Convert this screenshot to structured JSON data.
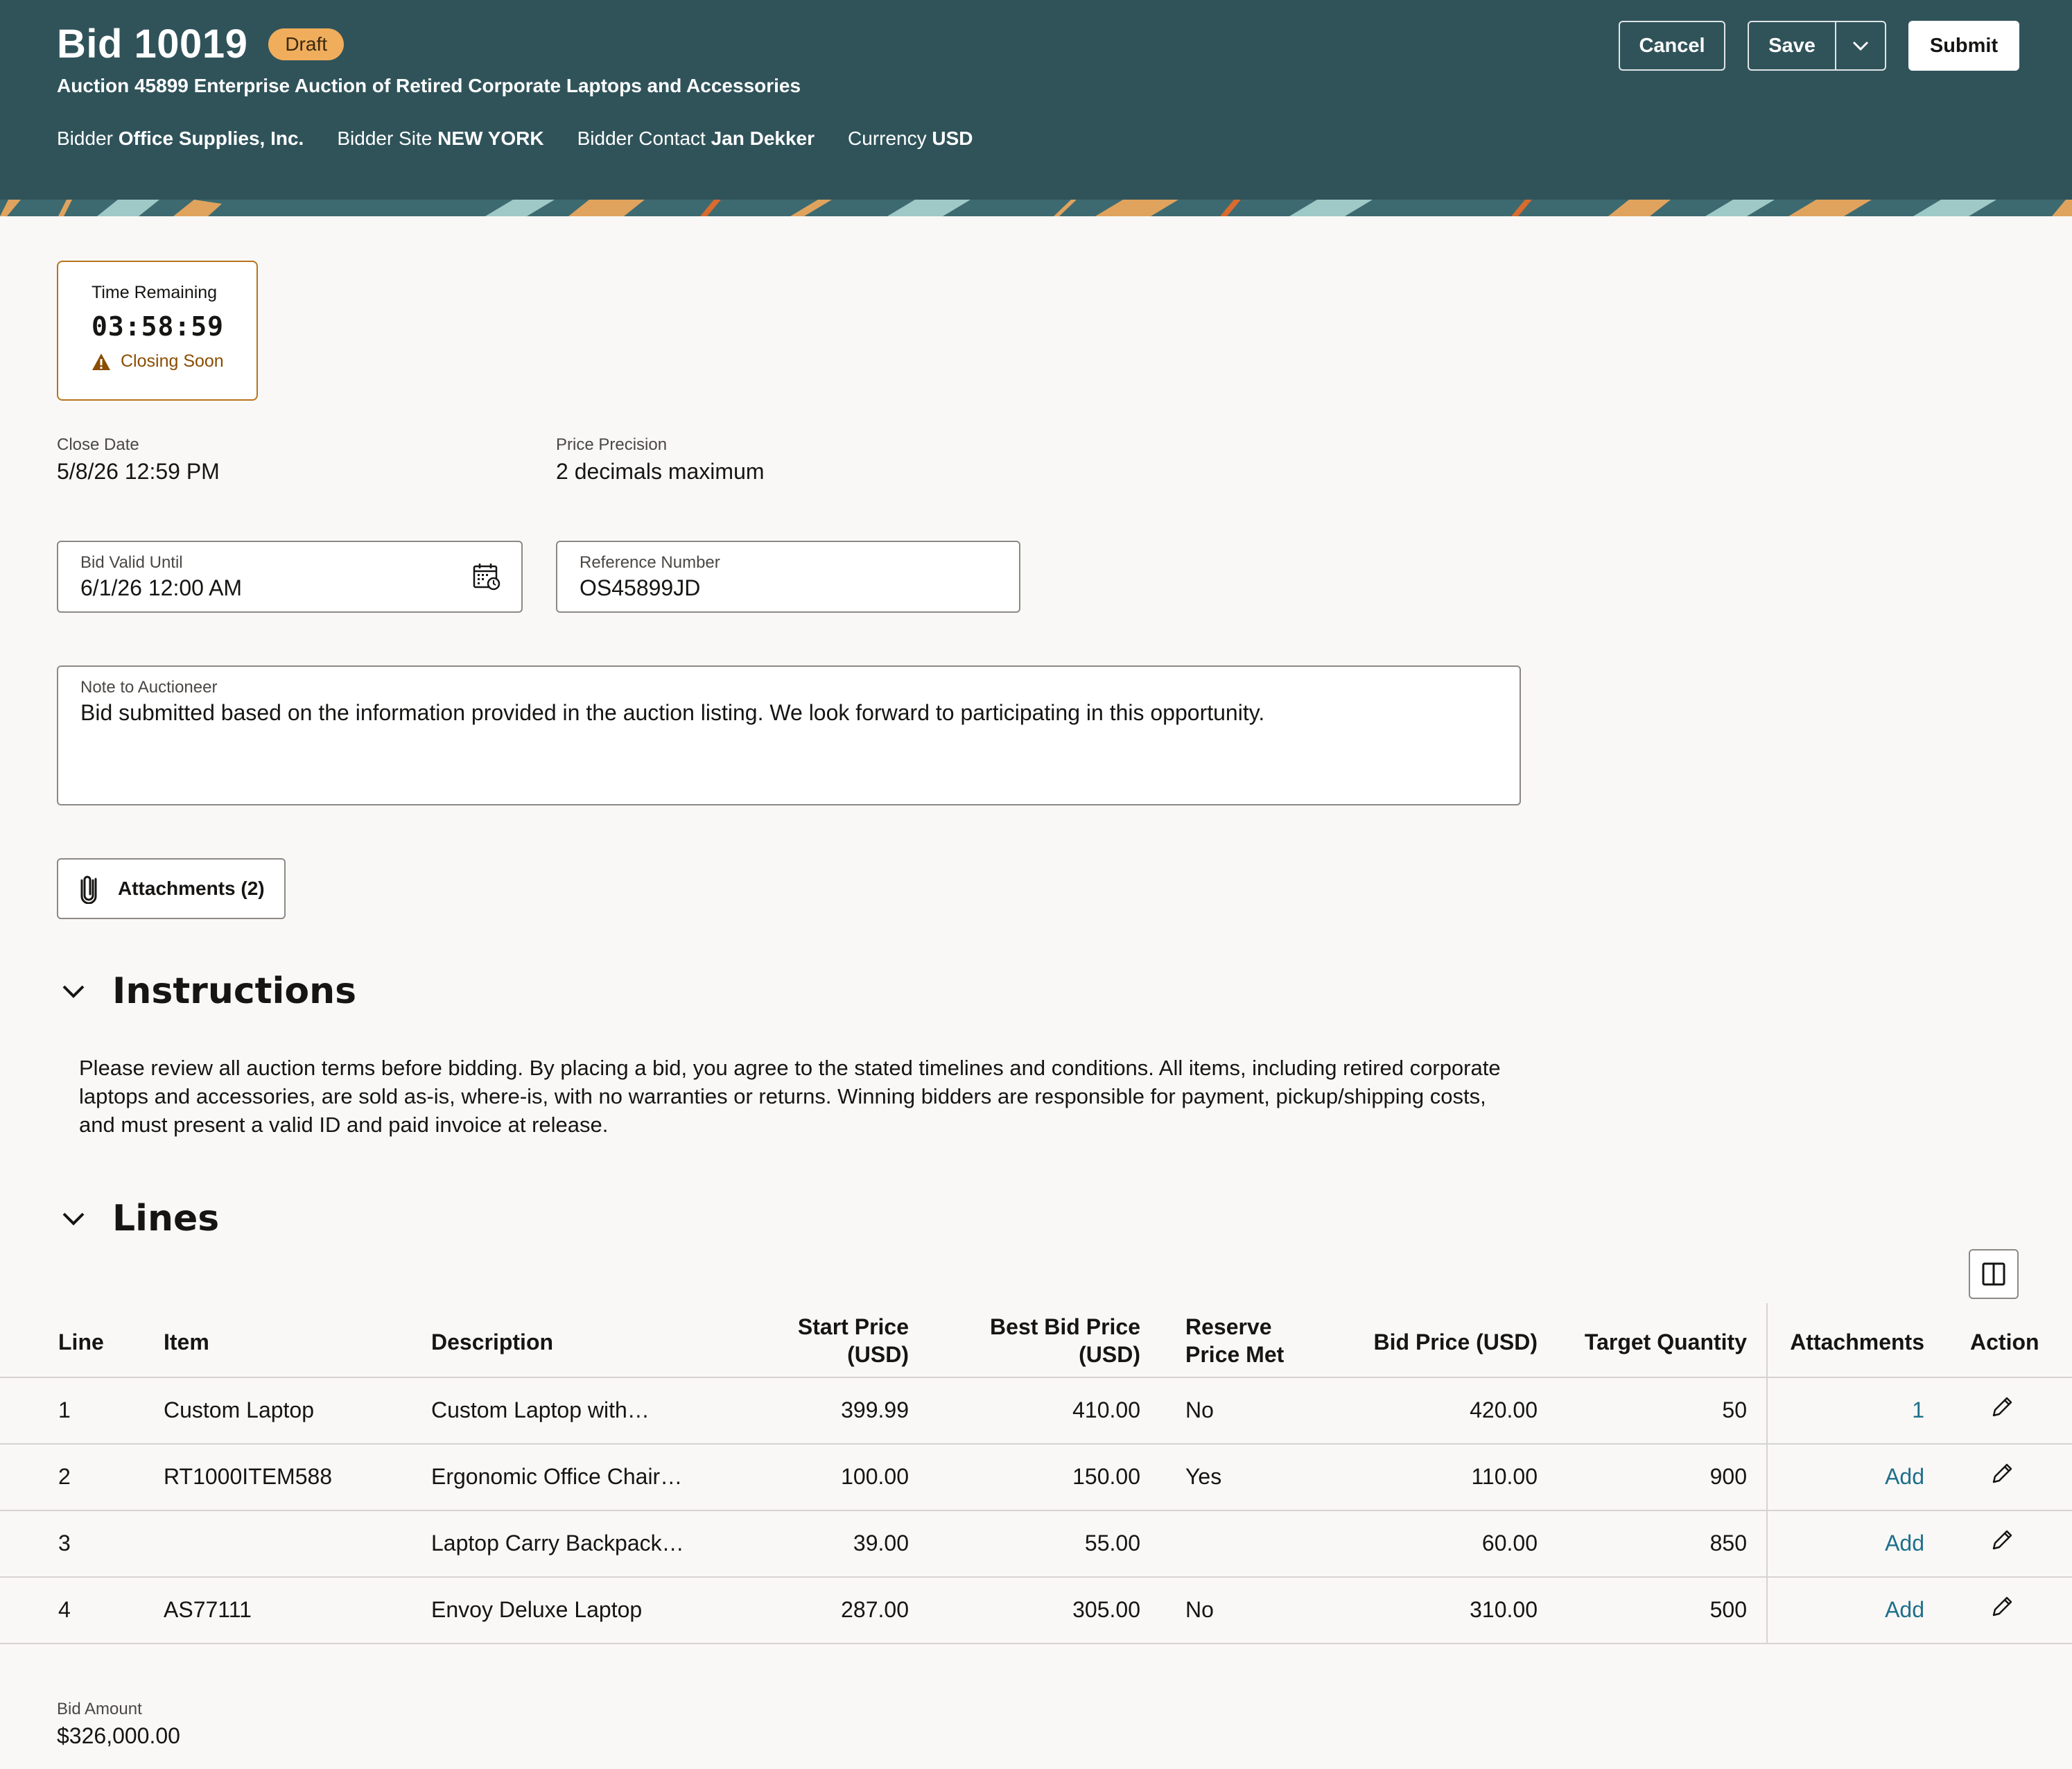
{
  "header": {
    "title": "Bid 10019",
    "status": "Draft",
    "subtitle": "Auction 45899 Enterprise Auction of Retired Corporate Laptops and Accessories",
    "meta": {
      "bidder_label": "Bidder",
      "bidder_value": "Office Supplies, Inc.",
      "site_label": "Bidder Site",
      "site_value": "NEW YORK",
      "contact_label": "Bidder Contact",
      "contact_value": "Jan Dekker",
      "currency_label": "Currency",
      "currency_value": "USD"
    },
    "buttons": {
      "cancel": "Cancel",
      "save": "Save",
      "submit": "Submit"
    },
    "colors": {
      "header_bg": "#30535a",
      "badge_bg": "#f0ad5c"
    }
  },
  "timer": {
    "label": "Time Remaining",
    "value": "03:58:59",
    "status": "Closing Soon"
  },
  "fields": {
    "close_date_label": "Close Date",
    "close_date_value": "5/8/26 12:59 PM",
    "price_precision_label": "Price Precision",
    "price_precision_value": "2 decimals maximum",
    "bid_valid_label": "Bid Valid Until",
    "bid_valid_value": "6/1/26 12:00 AM",
    "reference_label": "Reference Number",
    "reference_value": "OS45899JD",
    "note_label": "Note to Auctioneer",
    "note_value": "Bid submitted based on the information provided in the auction listing. We look forward to participating in this opportunity."
  },
  "attachments_button": "Attachments (2)",
  "instructions": {
    "title": "Instructions",
    "text": "Please review all auction terms before bidding. By placing a bid, you agree to the stated timelines and conditions. All items, including retired corporate laptops and accessories, are sold as-is, where-is, with no warranties or returns. Winning bidders are responsible for payment, pickup/shipping costs, and must present a valid ID and paid invoice at release."
  },
  "lines": {
    "title": "Lines",
    "columns": {
      "line": "Line",
      "item": "Item",
      "description": "Description",
      "start_price_1": "Start Price",
      "start_price_2": "(USD)",
      "best_bid_1": "Best Bid Price",
      "best_bid_2": "(USD)",
      "reserve_1": "Reserve",
      "reserve_2": "Price Met",
      "bid_price": "Bid Price (USD)",
      "target_qty": "Target Quantity",
      "attachments": "Attachments",
      "action": "Action"
    },
    "rows": [
      {
        "line": "1",
        "item": "Custom Laptop",
        "description": "Custom Laptop with…",
        "start_price": "399.99",
        "best_bid": "410.00",
        "reserve_met": "No",
        "bid_price": "420.00",
        "target_qty": "50",
        "attachments": "1"
      },
      {
        "line": "2",
        "item": "RT1000ITEM588",
        "description": "Ergonomic Office Chair…",
        "start_price": "100.00",
        "best_bid": "150.00",
        "reserve_met": "Yes",
        "bid_price": "110.00",
        "target_qty": "900",
        "attachments": "Add"
      },
      {
        "line": "3",
        "item": "",
        "description": "Laptop Carry Backpack…",
        "start_price": "39.00",
        "best_bid": "55.00",
        "reserve_met": "",
        "bid_price": "60.00",
        "target_qty": "850",
        "attachments": "Add"
      },
      {
        "line": "4",
        "item": "AS77111",
        "description": "Envoy Deluxe Laptop",
        "start_price": "287.00",
        "best_bid": "305.00",
        "reserve_met": "No",
        "bid_price": "310.00",
        "target_qty": "500",
        "attachments": "Add"
      }
    ]
  },
  "bid_amount": {
    "label": "Bid Amount",
    "value": "$326,000.00"
  }
}
